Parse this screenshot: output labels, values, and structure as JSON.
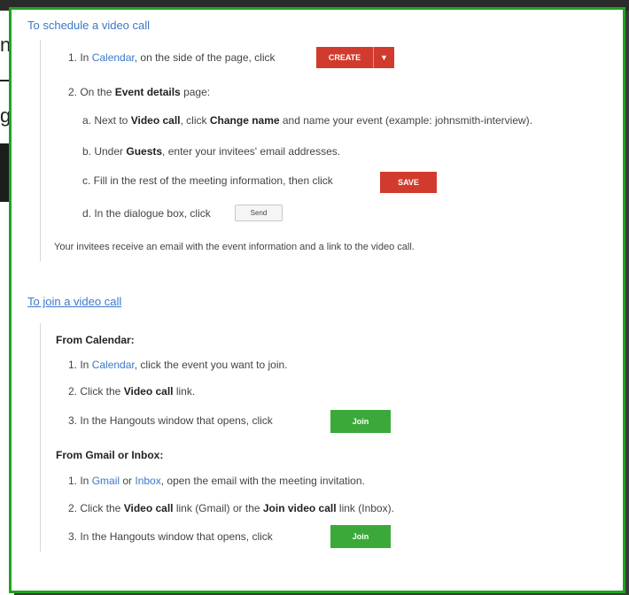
{
  "background": {
    "fragments": [
      "n",
      "g"
    ]
  },
  "schedule": {
    "heading": "To schedule a video call",
    "step1": {
      "pre": "1. In ",
      "link": "Calendar",
      "post": ", on the side of the page, click",
      "button": "CREATE",
      "button_arrow": "▼"
    },
    "step2": {
      "pre": "2. On the ",
      "bold": "Event details",
      "post": " page:"
    },
    "a": {
      "pre": "a. Next to ",
      "bold1": "Video call",
      "mid": ", click ",
      "bold2": "Change name",
      "post": " and name your event (example: johnsmith-interview)."
    },
    "b": {
      "pre": "b. Under ",
      "bold": "Guests",
      "post": ", enter your invitees' email addresses."
    },
    "c": {
      "text": "c. Fill in the rest of the meeting information, then click",
      "button": "SAVE"
    },
    "d": {
      "text": "d. In the dialogue box, click",
      "button": "Send"
    },
    "note": "Your invitees receive an email with the event information and a link to the video call."
  },
  "join": {
    "heading": "To join a video call",
    "calendar": {
      "title": "From Calendar:",
      "s1": {
        "pre": "1. In ",
        "link": "Calendar",
        "post": ", click the event you want to join."
      },
      "s2": {
        "pre": "2. Click the ",
        "bold": "Video call",
        "post": " link."
      },
      "s3": {
        "text": "3. In the Hangouts window that opens, click",
        "button": "Join"
      }
    },
    "gmail": {
      "title": "From Gmail or Inbox:",
      "s1": {
        "pre": "1. In ",
        "link1": "Gmail",
        "mid": " or ",
        "link2": "Inbox",
        "post": ", open the email with the meeting invitation."
      },
      "s2": {
        "pre": "2. Click the ",
        "bold1": "Video call",
        "mid": " link (Gmail) or the ",
        "bold2": "Join video call",
        "post": " link (Inbox)."
      },
      "s3": {
        "text": "3. In the Hangouts window that opens, click",
        "button": "Join"
      }
    }
  },
  "colors": {
    "border": "#1fa31f",
    "link": "#3b78c9",
    "red_button": "#d13b2e",
    "green_button": "#3aa93a"
  }
}
